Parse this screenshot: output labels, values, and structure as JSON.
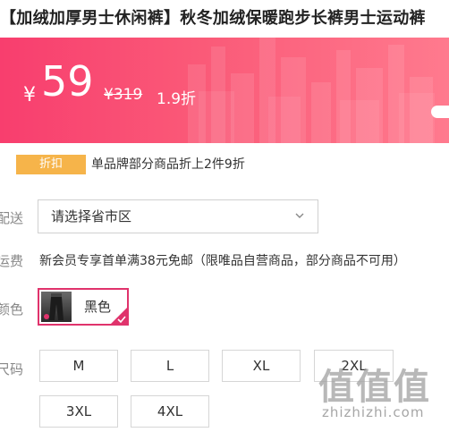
{
  "product": {
    "title": "【加绒加厚男士休闲裤】秋冬加绒保暖跑步长裤男士运动裤"
  },
  "price_banner": {
    "currency_symbol": "¥",
    "price": "59",
    "original_price": "¥319",
    "discount": "1.9折",
    "accent_color": "#f83e6e"
  },
  "promotion": {
    "badge": "折扣",
    "text": "单品牌部分商品折上2件9折",
    "badge_color": "#f6b44a"
  },
  "delivery": {
    "label": "配送",
    "select_value": "请选择省市区",
    "chevron_icon": "chevron-down-icon"
  },
  "shipping": {
    "label": "运费",
    "text": "新会员专享首单满38元免邮（限唯品自营商品，部分商品不可用）"
  },
  "color": {
    "label": "颜色",
    "options": [
      {
        "name": "黑色",
        "selected": true
      }
    ],
    "selected_color": "#e0336c"
  },
  "size": {
    "label": "尺码",
    "options": [
      "M",
      "L",
      "XL",
      "2XL",
      "3XL",
      "4XL"
    ]
  },
  "watermark": {
    "logo": "值值值",
    "domain": "zhizhizhi.com"
  }
}
